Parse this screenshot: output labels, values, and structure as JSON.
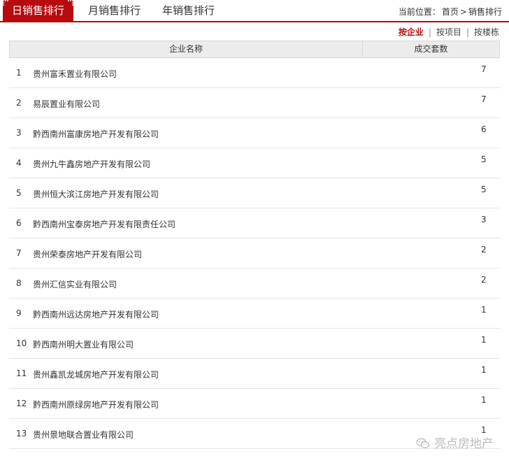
{
  "tabs": [
    {
      "label": "日销售排行",
      "active": true
    },
    {
      "label": "月销售排行",
      "active": false
    },
    {
      "label": "年销售排行",
      "active": false
    }
  ],
  "breadcrumb": {
    "prefix": "当前位置：",
    "home": "首页",
    "separator": ">",
    "current": "销售排行"
  },
  "sort_options": [
    {
      "label": "按企业",
      "active": true
    },
    {
      "label": "按项目",
      "active": false
    },
    {
      "label": "按楼栋",
      "active": false
    }
  ],
  "sort_separator": "|",
  "table": {
    "headers": [
      "企业名称",
      "成交套数"
    ],
    "rows": [
      {
        "idx": "1",
        "name": "贵州富禾置业有限公司",
        "count": "7"
      },
      {
        "idx": "2",
        "name": "易辰置业有限公司",
        "count": "7"
      },
      {
        "idx": "3",
        "name": "黔西南州富康房地产开发有限公司",
        "count": "6"
      },
      {
        "idx": "4",
        "name": "贵州九牛鑫房地产开发有限公司",
        "count": "5"
      },
      {
        "idx": "5",
        "name": "贵州恒大滨江房地产开发有限公司",
        "count": "5"
      },
      {
        "idx": "6",
        "name": "黔西南州宝泰房地产开发有限责任公司",
        "count": "3"
      },
      {
        "idx": "7",
        "name": "贵州荣泰房地产开发有限公司",
        "count": "2"
      },
      {
        "idx": "8",
        "name": "贵州汇信实业有限公司",
        "count": "2"
      },
      {
        "idx": "9",
        "name": "黔西南州远达房地产开发有限公司",
        "count": "1"
      },
      {
        "idx": "10",
        "name": "黔西南州明大置业有限公司",
        "count": "1"
      },
      {
        "idx": "11",
        "name": "贵州鑫凯龙城房地产开发有限公司",
        "count": "1"
      },
      {
        "idx": "12",
        "name": "黔西南州原绿房地产开发有限公司",
        "count": "1"
      },
      {
        "idx": "13",
        "name": "贵州景地联合置业有限公司",
        "count": "1"
      }
    ]
  },
  "watermark": {
    "text": "亮点房地产",
    "icon": "wechat-icon"
  },
  "colors": {
    "accent": "#b8070c",
    "header_bg": "#ececec",
    "watermark": "#bbbbbb"
  }
}
